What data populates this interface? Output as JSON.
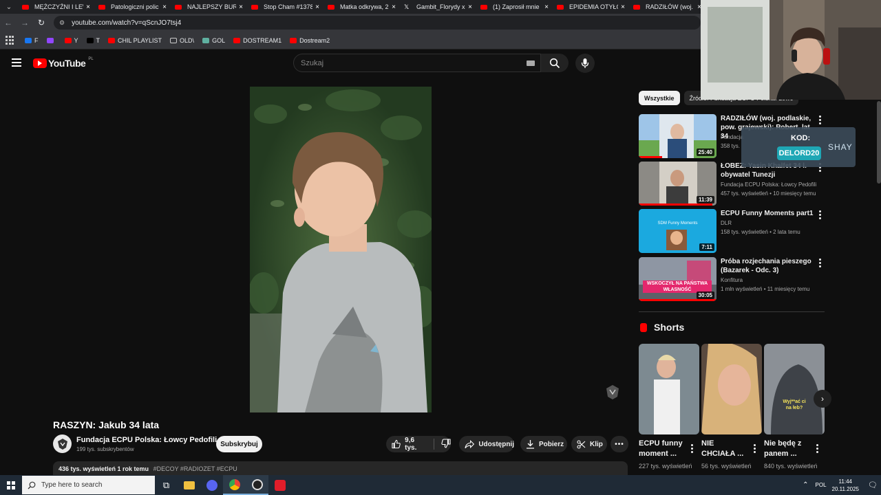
{
  "browser": {
    "tabs": [
      {
        "title": "MĘŻCZYŹNI I LEW",
        "icon": "youtube"
      },
      {
        "title": "Patologiczni polic",
        "icon": "youtube"
      },
      {
        "title": "NAJLEPSZY BURG",
        "icon": "youtube"
      },
      {
        "title": "Stop Cham #1378",
        "icon": "youtube"
      },
      {
        "title": "Matka odkrywa, 2",
        "icon": "youtube"
      },
      {
        "title": "Gambit_Florydy x",
        "icon": "x"
      },
      {
        "title": "(1) Zaprosił mnie",
        "icon": "youtube"
      },
      {
        "title": "EPIDEMIA OTYŁOŚ",
        "icon": "youtube"
      },
      {
        "title": "RADZIŁÓW (woj.",
        "icon": "youtube"
      }
    ],
    "url": "youtube.com/watch?v=qScnJO7tsj4",
    "bookmarks": [
      {
        "label": "F",
        "color": "#1877f2"
      },
      {
        "label": "",
        "color": "#9146ff"
      },
      {
        "label": "Y",
        "color": "#ff0000"
      },
      {
        "label": "T",
        "color": "#000000"
      },
      {
        "label": "CHIL PLAYLIST",
        "color": "#ff0000"
      },
      {
        "label": "OLD\\",
        "color": "folder"
      },
      {
        "label": "GOL",
        "color": "#5fb0a0"
      },
      {
        "label": "DOSTREAM1",
        "color": "#ff0000"
      },
      {
        "label": "Dostream2",
        "color": "#ff0000"
      }
    ]
  },
  "youtube": {
    "logo": "YouTube",
    "region": "PL",
    "search_placeholder": "Szukaj"
  },
  "video": {
    "title": "RASZYN: Jakub 34 lata",
    "channel": "Fundacja ECPU Polska: Łowcy Pedofili",
    "subscribers": "199 tys. subskrybentów",
    "subscribe_label": "Subskrybuj",
    "likes": "9,6 tys.",
    "share_label": "Udostępnij",
    "download_label": "Pobierz",
    "clip_label": "Klip",
    "views_date": "436 tys. wyświetleń  1 rok temu",
    "tags": "#DECOY #RADIOZET #ECPU"
  },
  "sidebar": {
    "chips": [
      "Wszystkie",
      "Źródło: Fundacja ECPU Polska: Łowc"
    ],
    "recommendations": [
      {
        "title": "RADZIŁÓW (woj. podlaskie, pow. grajewski): Robert, lat 34",
        "channel": "Fundacja",
        "meta": "358 tys.",
        "duration": "25:40",
        "progress": 0.3,
        "thumb": "#5a7d4a"
      },
      {
        "title": "ŁOBEZ: Yasin Khalfet 34 l. obywatel Tunezji",
        "channel": "Fundacja ECPU Polska: Łowcy Pedofili",
        "meta": "457 tys. wyświetleń • 10 miesięcy temu",
        "duration": "11:39",
        "progress": 0.95,
        "thumb": "#8a8a88"
      },
      {
        "title": "ECPU Funny Moments part1",
        "channel": "DLR",
        "meta": "158 tys. wyświetleń • 2 lata temu",
        "duration": "7:11",
        "progress": 0,
        "thumb": "#1ba9df"
      },
      {
        "title": "Próba rozjechania pieszego (Bazarek - Odc. 3)",
        "channel": "Konfitura",
        "meta": "1 mln wyświetleń • 11 miesięcy temu",
        "duration": "30:05",
        "progress": 1.0,
        "thumb": "#6b7280"
      }
    ],
    "rec3_thumb_text": "SDM Funny Moments",
    "rec4_thumb_text": "WSKOCZYŁ NA PAŃSTWA WŁASNOŚĆ"
  },
  "shorts": {
    "heading": "Shorts",
    "items": [
      {
        "title": "ECPU funny moment ...",
        "views": "227 tys. wyświetleń"
      },
      {
        "title": "NIE CHCIAŁA ...",
        "views": "56 tys. wyświetleń"
      },
      {
        "title": "Nie będę z panem ...",
        "views": "840 tys. wyświetleń"
      }
    ],
    "short3_caption": "Wyj**ać ci na łeb?"
  },
  "overlay": {
    "promo_label": "KOD:",
    "promo_code": "DELORD20",
    "promo_brand": "SHAY"
  },
  "taskbar": {
    "search_placeholder": "Type here to search",
    "language": "POL",
    "time": "11:44",
    "date": "20.11.2025"
  }
}
